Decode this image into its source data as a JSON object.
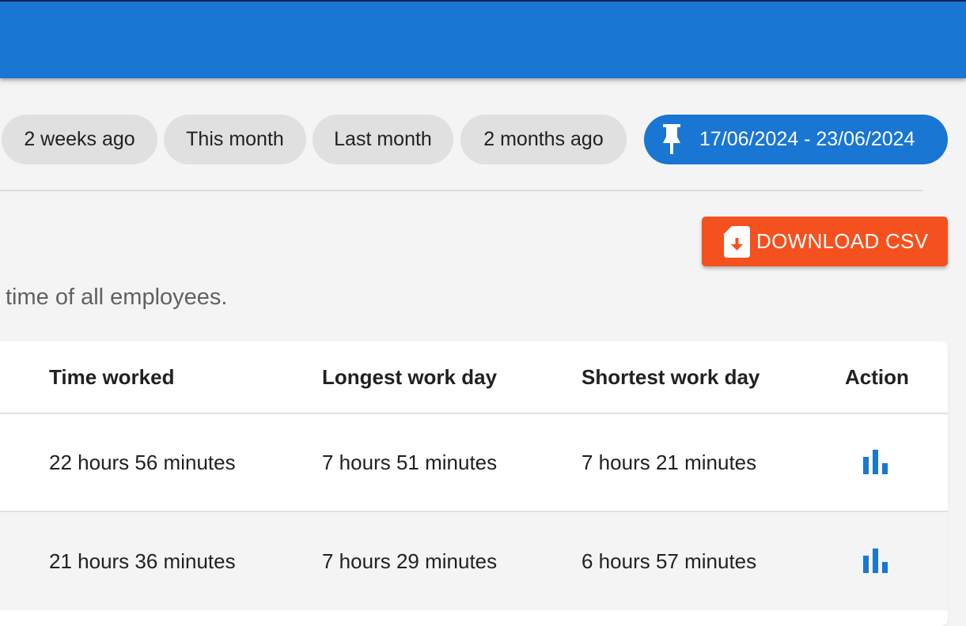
{
  "app_bar": {
    "color": "#1976d2"
  },
  "period_chips": [
    {
      "label": "2 weeks ago"
    },
    {
      "label": "This month"
    },
    {
      "label": "Last month"
    },
    {
      "label": "2 months ago"
    }
  ],
  "selected_range": {
    "label": "17/06/2024 - 23/06/2024",
    "icon": "pin-icon",
    "color": "#1976d2"
  },
  "download_button": {
    "label": "DOWNLOAD CSV",
    "icon": "file-download-icon",
    "color": "#f4511e"
  },
  "subtitle": "time of all employees.",
  "table": {
    "columns": [
      "Time worked",
      "Longest work day",
      "Shortest work day",
      "Action"
    ],
    "rows": [
      {
        "time_worked": "22 hours 56 minutes",
        "longest": "7 hours 51 minutes",
        "shortest": "7 hours 21 minutes",
        "action_icon": "bar-chart-icon"
      },
      {
        "time_worked": "21 hours 36 minutes",
        "longest": "7 hours 29 minutes",
        "shortest": "6 hours 57 minutes",
        "action_icon": "bar-chart-icon"
      }
    ]
  }
}
